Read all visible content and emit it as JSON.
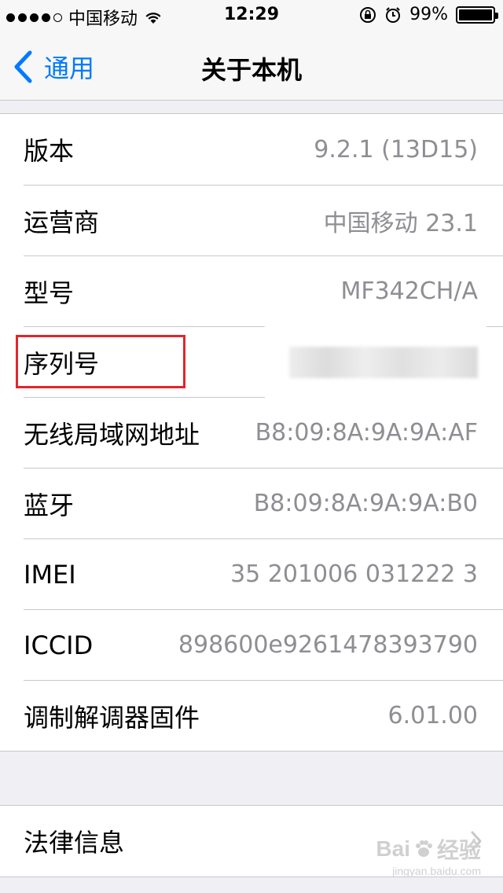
{
  "status_bar": {
    "carrier": "中国移动",
    "time": "12:29",
    "battery_percent": "99%",
    "battery_level": 0.99,
    "signal_bars_filled": 4,
    "signal_bars_total": 5,
    "icons": [
      "wifi-icon",
      "orientation-lock-icon",
      "alarm-icon",
      "battery-icon"
    ]
  },
  "nav": {
    "back_label": "通用",
    "title": "关于本机"
  },
  "rows": [
    {
      "label": "版本",
      "value": "9.2.1 (13D15)"
    },
    {
      "label": "运营商",
      "value": "中国移动 23.1"
    },
    {
      "label": "型号",
      "value": "MF342CH/A"
    },
    {
      "label": "序列号",
      "value": ""
    },
    {
      "label": "无线局域网地址",
      "value": "B8:09:8A:9A:9A:AF"
    },
    {
      "label": "蓝牙",
      "value": "B8:09:8A:9A:9A:B0"
    },
    {
      "label": "IMEI",
      "value": "35 201006 031222 3"
    },
    {
      "label": "ICCID",
      "value": "898600e9261478393790"
    },
    {
      "label": "调制解调器固件",
      "value": "6.01.00"
    }
  ],
  "legal": {
    "label": "法律信息"
  },
  "watermark": {
    "brand": "Bai",
    "brand_suffix": "经验",
    "url": "jingyan.baidu.com"
  },
  "colors": {
    "accent": "#007aff",
    "highlight": "#e3242b",
    "secondary_text": "#8e8e93",
    "group_background": "#efeff4"
  }
}
